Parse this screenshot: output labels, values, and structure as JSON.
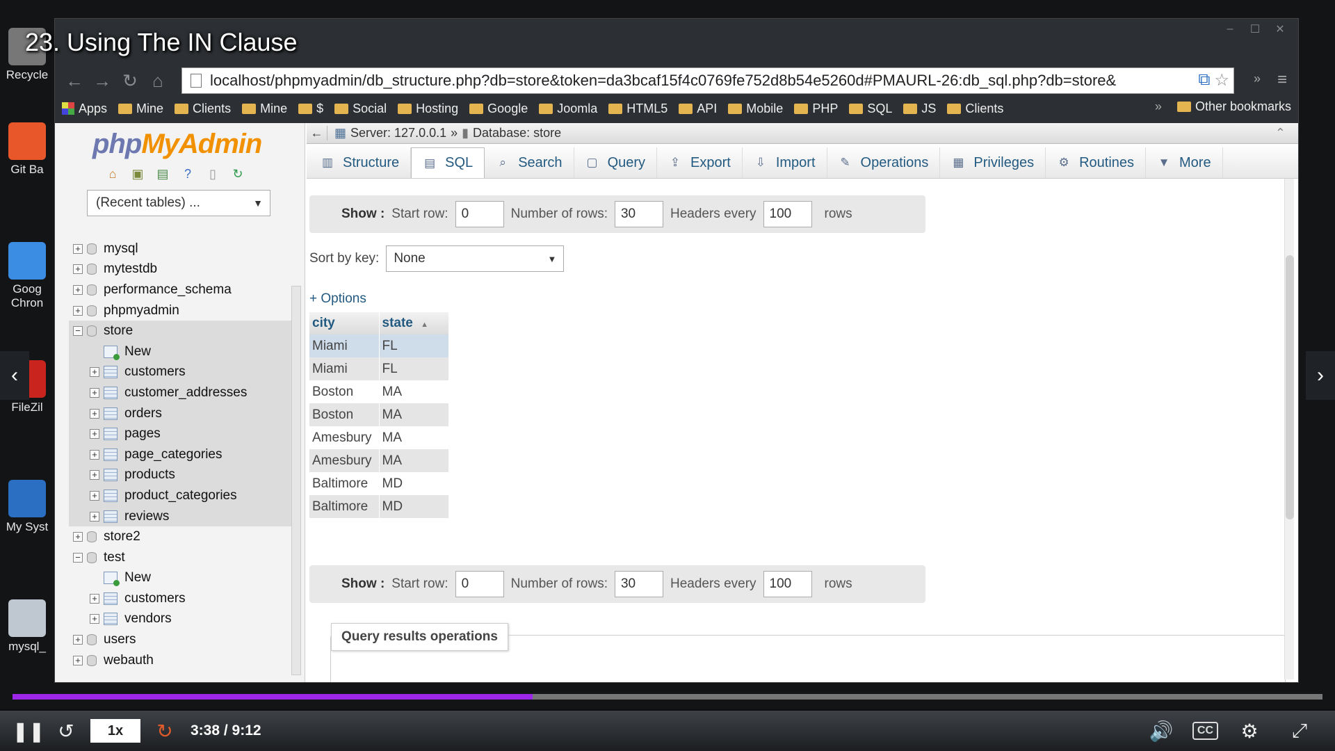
{
  "video": {
    "title": "23. Using The IN Clause",
    "time": "3:38 / 9:12",
    "speed": "1x",
    "progress_fraction": 0.397
  },
  "desktop_icons": [
    {
      "label": "Recycle",
      "icon": "recycle-bin-icon",
      "color": "#777777"
    },
    {
      "label": "Git Ba",
      "icon": "git-bash-icon",
      "color": "#e8572a"
    },
    {
      "label": "Goog Chron",
      "icon": "chrome-icon",
      "color": "#3b8de3"
    },
    {
      "label": "FileZil",
      "icon": "filezilla-icon",
      "color": "#c9251e"
    },
    {
      "label": "My Syst",
      "icon": "computer-icon",
      "color": "#2a6fc2"
    },
    {
      "label": "mysql_",
      "icon": "gear-icon",
      "color": "#bfc7d0"
    }
  ],
  "browser": {
    "url": "localhost/phpmyadmin/db_structure.php?db=store&token=da3bcaf15f4c0769fe752d8b54e5260d#PMAURL-26:db_sql.php?db=store&",
    "bookmarks": [
      "Apps",
      "Mine",
      "Clients",
      "Mine",
      "$",
      "Social",
      "Hosting",
      "Google",
      "Joomla",
      "HTML5",
      "API",
      "Mobile",
      "PHP",
      "SQL",
      "JS",
      "Clients"
    ],
    "other_bookmarks": "Other bookmarks",
    "overflow": "»"
  },
  "sidebar": {
    "logo_php": "php",
    "logo_mya": "MyAdmin",
    "recent_tables": "(Recent tables) ...",
    "tree": [
      {
        "label": "mysql",
        "type": "db",
        "level": 0,
        "toggle": "+"
      },
      {
        "label": "mytestdb",
        "type": "db",
        "level": 0,
        "toggle": "+"
      },
      {
        "label": "performance_schema",
        "type": "db",
        "level": 0,
        "toggle": "+"
      },
      {
        "label": "phpmyadmin",
        "type": "db",
        "level": 0,
        "toggle": "+"
      },
      {
        "label": "store",
        "type": "db",
        "level": 0,
        "toggle": "−",
        "selected": true
      },
      {
        "label": "New",
        "type": "new",
        "level": 1,
        "toggle": "",
        "selected": true
      },
      {
        "label": "customers",
        "type": "table",
        "level": 1,
        "toggle": "+",
        "selected": true
      },
      {
        "label": "customer_addresses",
        "type": "table",
        "level": 1,
        "toggle": "+",
        "selected": true
      },
      {
        "label": "orders",
        "type": "table",
        "level": 1,
        "toggle": "+",
        "selected": true
      },
      {
        "label": "pages",
        "type": "table",
        "level": 1,
        "toggle": "+",
        "selected": true
      },
      {
        "label": "page_categories",
        "type": "table",
        "level": 1,
        "toggle": "+",
        "selected": true
      },
      {
        "label": "products",
        "type": "table",
        "level": 1,
        "toggle": "+",
        "selected": true
      },
      {
        "label": "product_categories",
        "type": "table",
        "level": 1,
        "toggle": "+",
        "selected": true
      },
      {
        "label": "reviews",
        "type": "table",
        "level": 1,
        "toggle": "+",
        "selected": true
      },
      {
        "label": "store2",
        "type": "db",
        "level": 0,
        "toggle": "+"
      },
      {
        "label": "test",
        "type": "db",
        "level": 0,
        "toggle": "−"
      },
      {
        "label": "New",
        "type": "new",
        "level": 1,
        "toggle": ""
      },
      {
        "label": "customers",
        "type": "table",
        "level": 1,
        "toggle": "+"
      },
      {
        "label": "vendors",
        "type": "table",
        "level": 1,
        "toggle": "+"
      },
      {
        "label": "users",
        "type": "db",
        "level": 0,
        "toggle": "+"
      },
      {
        "label": "webauth",
        "type": "db",
        "level": 0,
        "toggle": "+"
      }
    ]
  },
  "breadcrumb": {
    "server": "Server: 127.0.0.1",
    "separator": "»",
    "database": "Database: store"
  },
  "tabs": [
    {
      "label": "Structure",
      "icon": "structure-icon"
    },
    {
      "label": "SQL",
      "icon": "sql-icon",
      "active": true
    },
    {
      "label": "Search",
      "icon": "search-icon"
    },
    {
      "label": "Query",
      "icon": "query-icon"
    },
    {
      "label": "Export",
      "icon": "export-icon"
    },
    {
      "label": "Import",
      "icon": "import-icon"
    },
    {
      "label": "Operations",
      "icon": "wrench-icon"
    },
    {
      "label": "Privileges",
      "icon": "privileges-icon"
    },
    {
      "label": "Routines",
      "icon": "routines-icon"
    },
    {
      "label": "More",
      "icon": "triangle-down-icon"
    }
  ],
  "show_bar": {
    "show": "Show :",
    "start_row_label": "Start row:",
    "start_row": "0",
    "num_rows_label": "Number of rows:",
    "num_rows": "30",
    "headers_label": "Headers every",
    "headers": "100",
    "rows": "rows"
  },
  "sort": {
    "label": "Sort by key:",
    "value": "None"
  },
  "options_link": "+ Options",
  "results": {
    "columns": [
      "city",
      "state"
    ],
    "sort_indicator": "▲",
    "rows": [
      [
        "Miami",
        "FL"
      ],
      [
        "Miami",
        "FL"
      ],
      [
        "Boston",
        "MA"
      ],
      [
        "Boston",
        "MA"
      ],
      [
        "Amesbury",
        "MA"
      ],
      [
        "Amesbury",
        "MA"
      ],
      [
        "Baltimore",
        "MD"
      ],
      [
        "Baltimore",
        "MD"
      ]
    ]
  },
  "query_results_operations": {
    "legend": "Query results operations"
  }
}
